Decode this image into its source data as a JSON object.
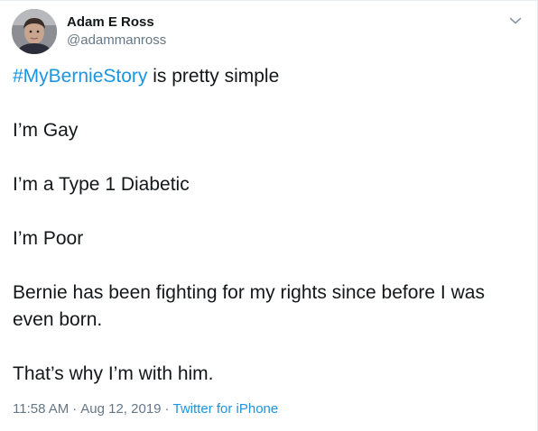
{
  "user": {
    "name": "Adam E Ross",
    "handle": "@adammanross"
  },
  "tweet": {
    "hashtag": "#MyBernieStory",
    "first_line_rest": " is pretty simple",
    "lines": [
      "I’m Gay",
      "I’m a Type 1 Diabetic",
      "I’m Poor",
      "Bernie has been fighting for my rights since before I was even born.",
      "That’s why I’m with him."
    ]
  },
  "meta": {
    "time": "11:58 AM",
    "separator": "·",
    "date": "Aug 12, 2019",
    "source": "Twitter for iPhone"
  },
  "colors": {
    "link": "#1b95e0",
    "secondary_text": "#657786",
    "primary_text": "#14171a"
  },
  "icons": {
    "menu": "chevron-down-icon"
  }
}
